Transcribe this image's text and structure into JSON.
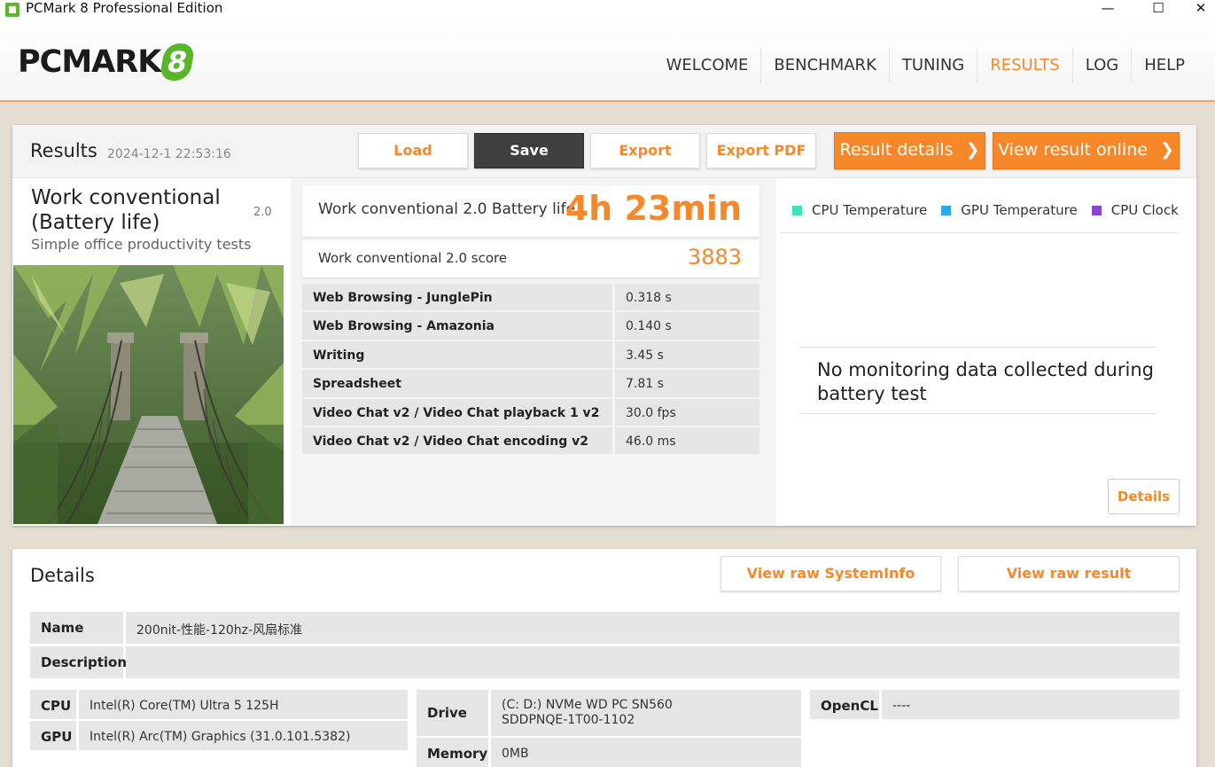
{
  "window": {
    "title": "PCMark 8 Professional Edition",
    "minimize_glyph": "—",
    "maximize_glyph": "☐",
    "close_glyph": "✕"
  },
  "logo": {
    "text": "PCMARK",
    "mark": "8"
  },
  "nav": {
    "items": [
      "WELCOME",
      "BENCHMARK",
      "TUNING",
      "RESULTS",
      "LOG",
      "HELP"
    ],
    "active": "RESULTS"
  },
  "results": {
    "title": "Results",
    "date": "2024-12-1 22:53:16",
    "buttons": {
      "load": "Load",
      "save": "Save",
      "export": "Export",
      "export_pdf": "Export PDF",
      "result_details": "Result details",
      "view_online": "View result online"
    },
    "test": {
      "name": "Work conventional (Battery life)",
      "version": "2.0",
      "description": "Simple office productivity tests"
    },
    "battery": {
      "label": "Work conventional 2.0 Battery life",
      "value": "4h 23min"
    },
    "score": {
      "label": "Work conventional 2.0 score",
      "value": "3883"
    },
    "subtests": [
      {
        "name": "Web Browsing - JunglePin",
        "value": "0.318 s"
      },
      {
        "name": "Web Browsing - Amazonia",
        "value": "0.140 s"
      },
      {
        "name": "Writing",
        "value": "3.45 s"
      },
      {
        "name": "Spreadsheet",
        "value": "7.81 s"
      },
      {
        "name": "Video Chat v2 / Video Chat playback 1 v2",
        "value": "30.0 fps"
      },
      {
        "name": "Video Chat v2 / Video Chat encoding v2",
        "value": "46.0 ms"
      }
    ],
    "monitoring": {
      "legend": [
        {
          "label": "CPU Temperature",
          "color": "#3fe0b8"
        },
        {
          "label": "GPU Temperature",
          "color": "#2ba8e8"
        },
        {
          "label": "CPU Clock",
          "color": "#8c44c8"
        }
      ],
      "no_data": "No monitoring data collected during battery test",
      "details_button": "Details"
    }
  },
  "details": {
    "title": "Details",
    "view_systeminfo": "View raw SystemInfo",
    "view_raw_result": "View raw result",
    "name_label": "Name",
    "name_value": "200nit-性能-120hz-风扇标准",
    "description_label": "Description",
    "description_value": "",
    "cpu_label": "CPU",
    "cpu_value": "Intel(R) Core(TM) Ultra 5 125H",
    "gpu_label": "GPU",
    "gpu_value": "Intel(R) Arc(TM) Graphics (31.0.101.5382)",
    "drive_label": "Drive",
    "drive_value_1": "(C: D:) NVMe WD PC SN560",
    "drive_value_2": "SDDPNQE-1T00-1102",
    "memory_label": "Memory",
    "memory_value": "0MB",
    "opencl_label": "OpenCL",
    "opencl_value": "----"
  },
  "colors": {
    "accent": "#f7882a",
    "brand_green": "#58b62a"
  }
}
